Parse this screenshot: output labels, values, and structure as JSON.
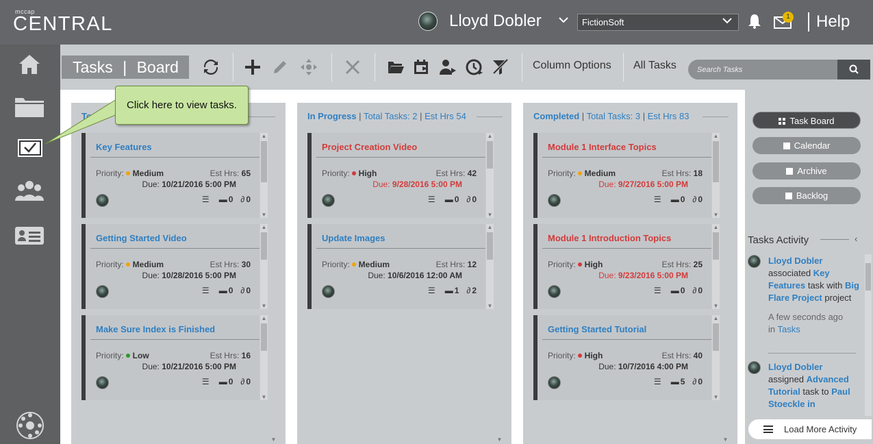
{
  "app": {
    "logo_small": "mccap",
    "logo_big": "CENTRAL"
  },
  "header": {
    "user_name": "Lloyd Dobler",
    "company": "FictionSoft",
    "notification_count": "1",
    "help_label": "Help"
  },
  "toolbar": {
    "tasks_label": "Tasks",
    "separator": "|",
    "board_label": "Board",
    "column_options_label": "Column Options",
    "all_tasks_label": "All Tasks",
    "search_placeholder": "Search Tasks"
  },
  "callout": {
    "text": "Click here to view tasks."
  },
  "columns": [
    {
      "name": "To Do",
      "head_visible": "To",
      "cards": [
        {
          "title": "Key Features",
          "priority": "Medium",
          "priority_color": "#f0a30a",
          "est_hrs": "65",
          "due": "10/21/2016 5:00 PM",
          "overdue": false,
          "comments": "0",
          "attachments": "0"
        },
        {
          "title": "Getting Started Video",
          "priority": "Medium",
          "priority_color": "#f0a30a",
          "est_hrs": "30",
          "due": "10/28/2016 5:00 PM",
          "overdue": false,
          "comments": "0",
          "attachments": "0"
        },
        {
          "title": "Make Sure Index is Finished",
          "priority": "Low",
          "priority_color": "#2a9a2a",
          "est_hrs": "16",
          "due": "10/21/2016 5:00 PM",
          "overdue": false,
          "comments": "0",
          "attachments": "0"
        }
      ]
    },
    {
      "name": "In Progress",
      "total_tasks": "Total Tasks: 2",
      "est_hrs": "Est Hrs 54",
      "cards": [
        {
          "title": "Project Creation Video",
          "priority": "High",
          "priority_color": "#d23b3b",
          "est_hrs": "42",
          "due": "9/28/2016 5:00 PM",
          "overdue": true,
          "comments": "0",
          "attachments": "0"
        },
        {
          "title": "Update Images",
          "priority": "Medium",
          "priority_color": "#f0a30a",
          "est_hrs": "12",
          "due": "10/6/2016 12:00 AM",
          "overdue": false,
          "comments": "1",
          "attachments": "2"
        }
      ]
    },
    {
      "name": "Completed",
      "total_tasks": "Total Tasks: 3",
      "est_hrs": "Est Hrs 83",
      "cards": [
        {
          "title": "Module 1 Interface Topics",
          "priority": "Medium",
          "priority_color": "#f0a30a",
          "est_hrs": "18",
          "due": "9/27/2016 5:00 PM",
          "overdue": true,
          "comments": "0",
          "attachments": "0"
        },
        {
          "title": "Module 1 Introduction Topics",
          "priority": "High",
          "priority_color": "#d23b3b",
          "est_hrs": "25",
          "due": "9/23/2016 5:00 PM",
          "overdue": true,
          "comments": "0",
          "attachments": "0"
        },
        {
          "title": "Getting Started Tutorial",
          "priority": "High",
          "priority_color": "#d23b3b",
          "est_hrs": "40",
          "due": "10/7/2016 4:00 PM",
          "overdue": false,
          "comments": "5",
          "attachments": "0"
        }
      ]
    }
  ],
  "labels": {
    "priority": "Priority:",
    "est_hrs": "Est Hrs:",
    "due": "Due:"
  },
  "right_panel": {
    "buttons": [
      "Task Board",
      "Calendar",
      "Archive",
      "Backlog"
    ],
    "activity_title": "Tasks Activity",
    "activity": [
      {
        "user": "Lloyd Dobler",
        "verb": "associated",
        "task": "Key Features",
        "mid": "task with",
        "target": "Big Flare Project",
        "tail": "project",
        "time": "A few seconds ago",
        "in": "in",
        "where": "Tasks"
      },
      {
        "user": "Lloyd Dobler",
        "verb": "assigned",
        "task": "Advanced Tutorial",
        "mid": "task to",
        "target": "Paul Stoeckle in"
      }
    ],
    "load_more": "Load More Activity"
  }
}
